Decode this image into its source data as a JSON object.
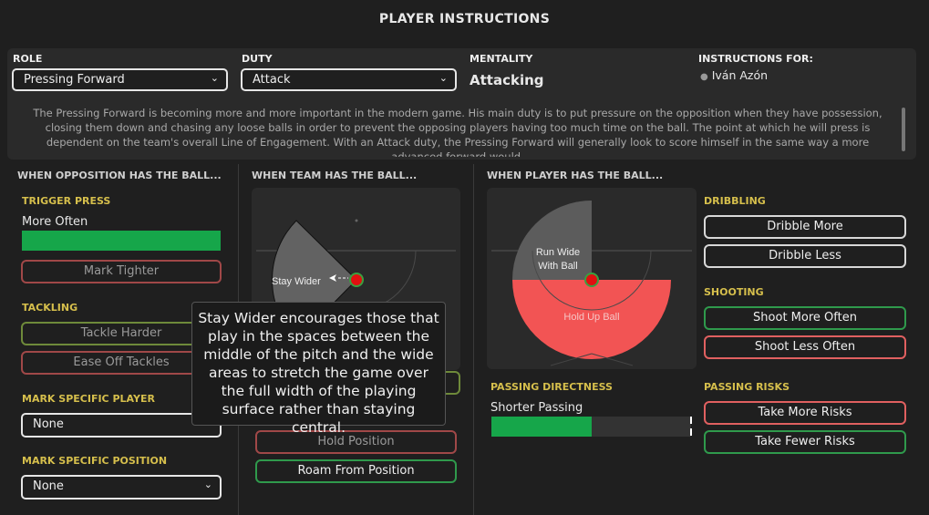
{
  "header": {
    "title": "PLAYER INSTRUCTIONS"
  },
  "top": {
    "role_label": "ROLE",
    "role_value": "Pressing Forward",
    "duty_label": "DUTY",
    "duty_value": "Attack",
    "mentality_label": "MENTALITY",
    "mentality_value": "Attacking",
    "instructions_for_label": "INSTRUCTIONS FOR:",
    "player_name": "Iván Azón",
    "description": "The Pressing Forward is becoming more and more important in the modern game. His main duty is to put pressure on the opposition when they have possession, closing them down and chasing any loose balls in order to prevent the opposing players having too much time on the ball. The point at which he will press is dependent on the team's overall Line of Engagement. With an Attack duty, the Pressing Forward will generally look to score himself in the same way a more advanced forward would."
  },
  "opposition": {
    "title": "WHEN OPPOSITION HAS THE BALL...",
    "trigger_press_label": "TRIGGER PRESS",
    "trigger_press_value": "More Often",
    "trigger_press_level": 1.0,
    "mark_tighter": "Mark Tighter",
    "tackling_label": "TACKLING",
    "tackle_harder": "Tackle Harder",
    "ease_off": "Ease Off Tackles",
    "mark_player_label": "MARK SPECIFIC PLAYER",
    "mark_player_value": "None",
    "mark_position_label": "MARK SPECIFIC POSITION",
    "mark_position_value": "None"
  },
  "team": {
    "title": "WHEN TEAM HAS THE BALL...",
    "movement_label": "Stay Wider",
    "hold_position": "Hold Position",
    "roam": "Roam From Position"
  },
  "player": {
    "title": "WHEN PLAYER HAS THE BALL...",
    "run_wide": "Run Wide With Ball",
    "hold_up": "Hold Up Ball",
    "dribbling_label": "DRIBBLING",
    "dribble_more": "Dribble More",
    "dribble_less": "Dribble Less",
    "shooting_label": "SHOOTING",
    "shoot_more": "Shoot More Often",
    "shoot_less": "Shoot Less Often",
    "passing_directness_label": "PASSING DIRECTNESS",
    "passing_directness_value": "Shorter Passing",
    "passing_directness_level": 0.5,
    "passing_risks_label": "PASSING RISKS",
    "take_more": "Take More Risks",
    "take_fewer": "Take Fewer Risks"
  },
  "tooltip": {
    "text": "Stay Wider encourages those that play in the spaces between the middle of the pitch and the wide areas to stretch the game over the full width of the playing surface rather than staying central."
  },
  "colors": {
    "accent_gold": "#d6bf4c",
    "green": "#16a64a",
    "red": "#f25454"
  }
}
